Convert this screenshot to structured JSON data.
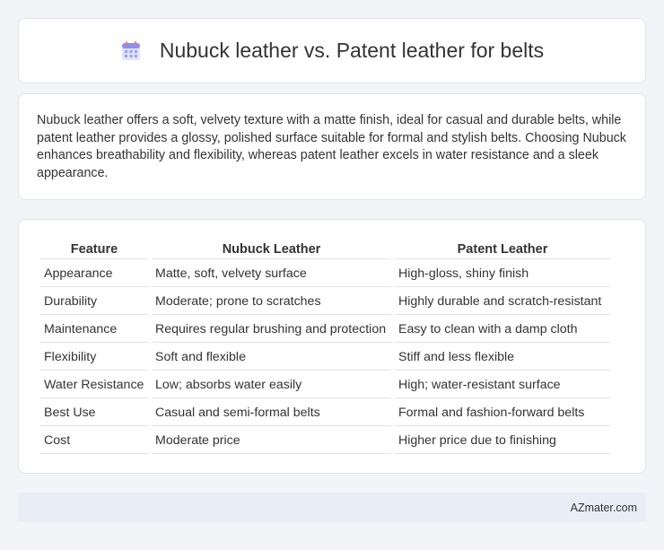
{
  "header": {
    "icon": "calendar-icon",
    "title": "Nubuck leather vs. Patent leather for belts"
  },
  "summary": {
    "text": "Nubuck leather offers a soft, velvety texture with a matte finish, ideal for casual and durable belts, while patent leather provides a glossy, polished surface suitable for formal and stylish belts. Choosing Nubuck enhances breathability and flexibility, whereas patent leather excels in water resistance and a sleek appearance."
  },
  "table": {
    "headers": [
      "Feature",
      "Nubuck Leather",
      "Patent Leather"
    ],
    "rows": [
      [
        "Appearance",
        "Matte, soft, velvety surface",
        "High-gloss, shiny finish"
      ],
      [
        "Durability",
        "Moderate; prone to scratches",
        "Highly durable and scratch-resistant"
      ],
      [
        "Maintenance",
        "Requires regular brushing and protection",
        "Easy to clean with a damp cloth"
      ],
      [
        "Flexibility",
        "Soft and flexible",
        "Stiff and less flexible"
      ],
      [
        "Water Resistance",
        "Low; absorbs water easily",
        "High; water-resistant surface"
      ],
      [
        "Best Use",
        "Casual and semi-formal belts",
        "Formal and fashion-forward belts"
      ],
      [
        "Cost",
        "Moderate price",
        "Higher price due to finishing"
      ]
    ]
  },
  "footer": {
    "brand": "AZmater.com"
  }
}
